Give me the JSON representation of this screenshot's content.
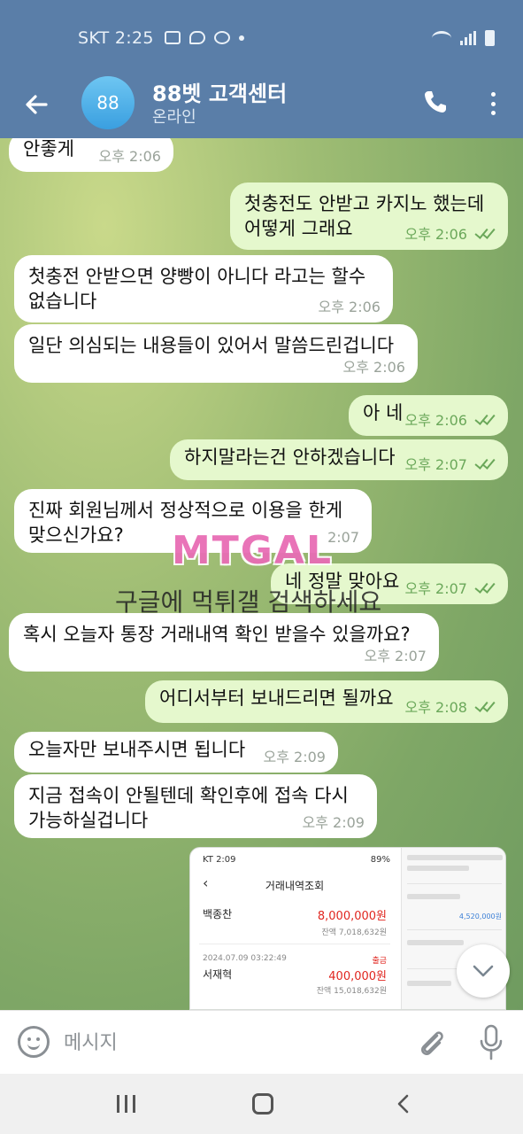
{
  "status_bar": {
    "carrier_time": "SKT 2:25"
  },
  "header": {
    "avatar_text": "88",
    "title": "88벳 고객센터",
    "status": "온라인"
  },
  "messages": [
    {
      "dir": "in",
      "text": "안좋게",
      "time": "오후 2:06"
    },
    {
      "dir": "out",
      "text": "첫충전도 안받고 카지노 했는데\n어떻게 그래요",
      "time": "오후 2:06"
    },
    {
      "dir": "in",
      "text": "첫충전 안받으면 양빵이 아니다 라고는 할수\n없습니다",
      "time": "오후 2:06"
    },
    {
      "dir": "in",
      "text": "일단 의심되는 내용들이 있어서 말씀드린겁니다",
      "time": "오후 2:06"
    },
    {
      "dir": "out",
      "text": "아 네",
      "time": "오후 2:06"
    },
    {
      "dir": "out",
      "text": "하지말라는건 안하겠습니다",
      "time": "오후 2:07"
    },
    {
      "dir": "in",
      "text": "진짜 회원님께서 정상적으로 이용을 한게\n맞으신가요?",
      "time": "2:07"
    },
    {
      "dir": "out",
      "text": "네 정말 맞아요",
      "time": "오후 2:07"
    },
    {
      "dir": "in",
      "text": "혹시 오늘자 통장 거래내역 확인 받을수 있을까요?",
      "time": "오후 2:07"
    },
    {
      "dir": "out",
      "text": "어디서부터 보내드리면 될까요",
      "time": "오후 2:08"
    },
    {
      "dir": "in",
      "text": "오늘자만 보내주시면 됩니다",
      "time": "오후 2:09"
    },
    {
      "dir": "in",
      "text": "지금 접속이 안될텐데 확인후에 접속 다시\n가능하실겁니다",
      "time": "오후 2:09"
    }
  ],
  "watermark": {
    "logo": "MTGAL",
    "text": "구글에 먹튀갤 검색하세요"
  },
  "image_preview": {
    "status_left": "KT 2:09",
    "status_right": "89%",
    "title": "거래내역조회",
    "rows": [
      {
        "name": "백종찬",
        "amount": "8,000,000원",
        "balance": "잔액 7,018,632원"
      },
      {
        "date": "2024.07.09 03:22:49",
        "name": "서재혁",
        "kind": "출금",
        "amount": "400,000원",
        "balance": "잔액 15,018,632원"
      }
    ],
    "right_amount": "4,520,000원"
  },
  "input": {
    "placeholder": "메시지"
  }
}
